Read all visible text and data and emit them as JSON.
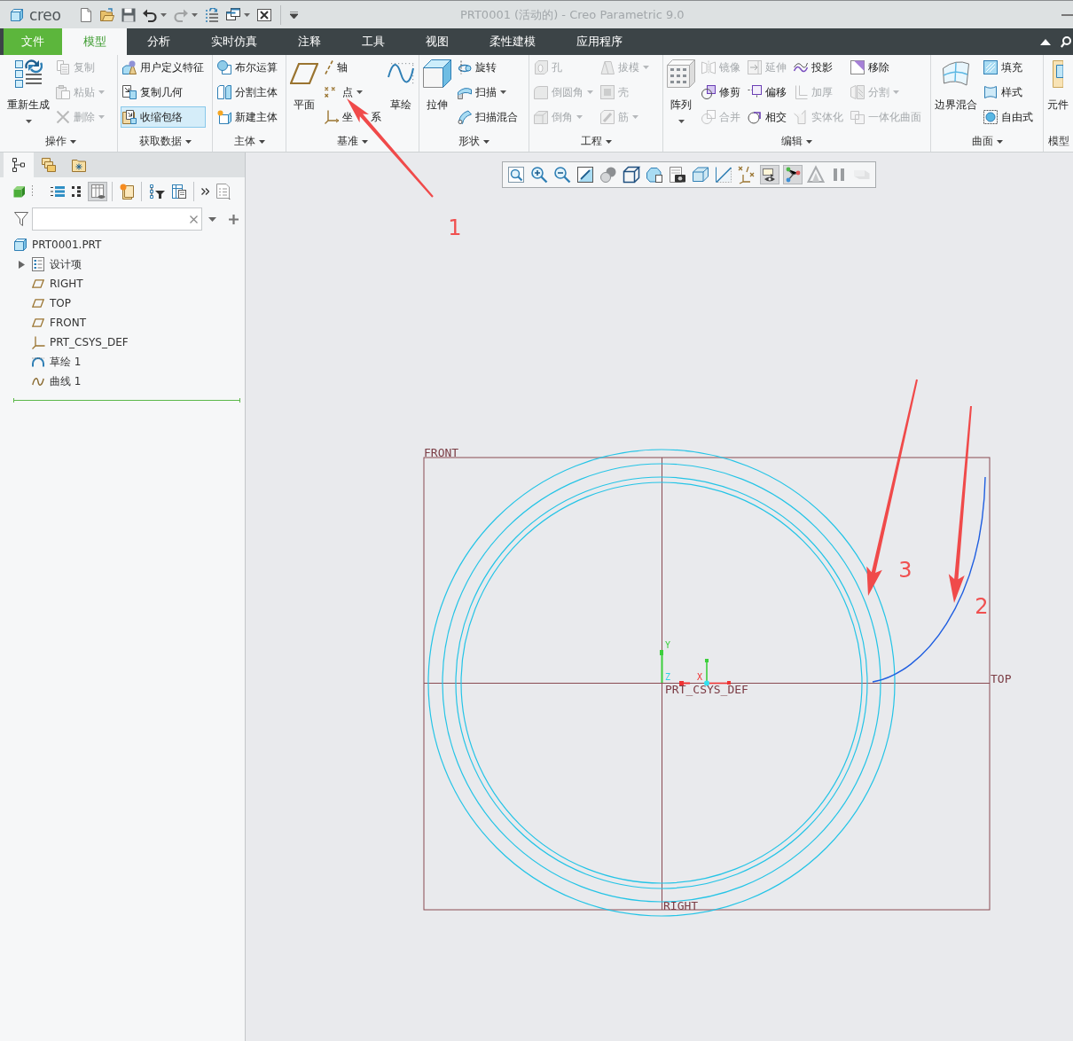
{
  "title_bar": {
    "logo": "creo",
    "title": "PRT0001 (活动的) - Creo Parametric 9.0",
    "quick_access": [
      {
        "dropdown": false,
        "disabled": false
      },
      {
        "dropdown": false,
        "disabled": false
      },
      {
        "dropdown": false,
        "disabled": false
      },
      {
        "dropdown": true,
        "disabled": false
      },
      {
        "dropdown": true,
        "disabled": true
      },
      {
        "dropdown": false,
        "disabled": false
      },
      {
        "dropdown": true,
        "disabled": false
      },
      {
        "dropdown": false,
        "disabled": false
      }
    ]
  },
  "menu_tabs": [
    {
      "label": "文件",
      "kind": "file",
      "selected": false
    },
    {
      "label": "模型",
      "kind": "tab",
      "selected": true
    },
    {
      "label": "分析",
      "kind": "tab",
      "selected": false
    },
    {
      "label": "实时仿真",
      "kind": "tab",
      "selected": false
    },
    {
      "label": "注释",
      "kind": "tab",
      "selected": false
    },
    {
      "label": "工具",
      "kind": "tab",
      "selected": false
    },
    {
      "label": "视图",
      "kind": "tab",
      "selected": false
    },
    {
      "label": "柔性建模",
      "kind": "tab",
      "selected": false
    },
    {
      "label": "应用程序",
      "kind": "tab",
      "selected": false
    }
  ],
  "ribbon_groups": [
    {
      "label": "操作",
      "dropdown": true,
      "columns": [
        [
          {
            "label": "重新生成",
            "kind": "large",
            "dropdown": true,
            "disabled": false,
            "active": false
          }
        ],
        [
          {
            "label": "复制",
            "kind": "small",
            "dropdown": false,
            "disabled": true,
            "active": false
          },
          {
            "label": "粘贴",
            "kind": "small",
            "dropdown": true,
            "disabled": true,
            "active": false
          },
          {
            "label": "删除",
            "kind": "small",
            "dropdown": true,
            "disabled": true,
            "active": false
          }
        ]
      ]
    },
    {
      "label": "获取数据",
      "dropdown": true,
      "columns": [
        [
          {
            "label": "用户定义特征",
            "kind": "small",
            "dropdown": false,
            "disabled": false,
            "active": false
          },
          {
            "label": "复制几何",
            "kind": "small",
            "dropdown": false,
            "disabled": false,
            "active": false
          },
          {
            "label": "收缩包络",
            "kind": "small",
            "dropdown": false,
            "disabled": false,
            "active": true
          }
        ]
      ]
    },
    {
      "label": "主体",
      "dropdown": true,
      "columns": [
        [
          {
            "label": "布尔运算",
            "kind": "small",
            "dropdown": false,
            "disabled": false,
            "active": false
          },
          {
            "label": "分割主体",
            "kind": "small",
            "dropdown": false,
            "disabled": false,
            "active": false
          },
          {
            "label": "新建主体",
            "kind": "small",
            "dropdown": false,
            "disabled": false,
            "active": false
          }
        ]
      ]
    },
    {
      "label": "基准",
      "dropdown": true,
      "columns": [
        [
          {
            "label": "平面",
            "kind": "large",
            "dropdown": false,
            "disabled": false,
            "active": false
          }
        ],
        [
          {
            "label": "轴",
            "kind": "small",
            "dropdown": false,
            "disabled": false,
            "active": false
          },
          {
            "label": "点",
            "kind": "small",
            "dropdown": true,
            "disabled": false,
            "active": false
          },
          {
            "label": "坐 系",
            "kind": "small",
            "dropdown": false,
            "disabled": false,
            "active": false
          }
        ],
        [
          {
            "label": "草绘",
            "kind": "large",
            "dropdown": false,
            "disabled": false,
            "active": false
          }
        ]
      ]
    },
    {
      "label": "形状",
      "dropdown": true,
      "columns": [
        [
          {
            "label": "拉伸",
            "kind": "large",
            "dropdown": false,
            "disabled": false,
            "active": false
          }
        ],
        [
          {
            "label": "旋转",
            "kind": "small",
            "dropdown": false,
            "disabled": false,
            "active": false
          },
          {
            "label": "扫描",
            "kind": "small",
            "dropdown": true,
            "disabled": false,
            "active": false
          },
          {
            "label": "扫描混合",
            "kind": "small",
            "dropdown": false,
            "disabled": false,
            "active": false
          }
        ]
      ]
    },
    {
      "label": "工程",
      "dropdown": true,
      "columns": [
        [
          {
            "label": "孔",
            "kind": "small",
            "dropdown": false,
            "disabled": true,
            "active": false
          },
          {
            "label": "倒圆角",
            "kind": "small",
            "dropdown": true,
            "disabled": true,
            "active": false
          },
          {
            "label": "倒角",
            "kind": "small",
            "dropdown": true,
            "disabled": true,
            "active": false
          }
        ],
        [
          {
            "label": "拔模",
            "kind": "small",
            "dropdown": true,
            "disabled": true,
            "active": false
          },
          {
            "label": "壳",
            "kind": "small",
            "dropdown": false,
            "disabled": true,
            "active": false
          },
          {
            "label": "筋",
            "kind": "small",
            "dropdown": true,
            "disabled": true,
            "active": false
          }
        ]
      ]
    },
    {
      "label": "编辑",
      "dropdown": true,
      "columns": [
        [
          {
            "label": "阵列",
            "kind": "large",
            "dropdown": true,
            "disabled": false,
            "active": false
          }
        ],
        [
          {
            "label": "镜像",
            "kind": "small",
            "dropdown": false,
            "disabled": true,
            "active": false
          },
          {
            "label": "修剪",
            "kind": "small",
            "dropdown": false,
            "disabled": false,
            "active": false
          },
          {
            "label": "合并",
            "kind": "small",
            "dropdown": false,
            "disabled": true,
            "active": false
          }
        ],
        [
          {
            "label": "延伸",
            "kind": "small",
            "dropdown": false,
            "disabled": true,
            "active": false
          },
          {
            "label": "偏移",
            "kind": "small",
            "dropdown": false,
            "disabled": false,
            "active": false
          },
          {
            "label": "相交",
            "kind": "small",
            "dropdown": false,
            "disabled": false,
            "active": false
          }
        ],
        [
          {
            "label": "投影",
            "kind": "small",
            "dropdown": false,
            "disabled": false,
            "active": false
          },
          {
            "label": "加厚",
            "kind": "small",
            "dropdown": false,
            "disabled": true,
            "active": false
          },
          {
            "label": "实体化",
            "kind": "small",
            "dropdown": false,
            "disabled": true,
            "active": false
          }
        ],
        [
          {
            "label": "移除",
            "kind": "small",
            "dropdown": false,
            "disabled": false,
            "active": false
          },
          {
            "label": "分割",
            "kind": "small",
            "dropdown": true,
            "disabled": true,
            "active": false
          },
          {
            "label": "一体化曲面",
            "kind": "small",
            "dropdown": false,
            "disabled": true,
            "active": false
          }
        ]
      ]
    },
    {
      "label": "曲面",
      "dropdown": true,
      "columns": [
        [
          {
            "label": "边界混合",
            "kind": "large",
            "dropdown": false,
            "disabled": false,
            "active": false
          }
        ],
        [
          {
            "label": "填充",
            "kind": "small",
            "dropdown": false,
            "disabled": false,
            "active": false
          },
          {
            "label": "样式",
            "kind": "small",
            "dropdown": false,
            "disabled": false,
            "active": false
          },
          {
            "label": "自由式",
            "kind": "small",
            "dropdown": false,
            "disabled": false,
            "active": false
          }
        ]
      ]
    },
    {
      "label": "模型",
      "dropdown": false,
      "columns": [
        [
          {
            "label": "元件",
            "kind": "large",
            "dropdown": false,
            "disabled": false,
            "active": false
          }
        ]
      ]
    }
  ],
  "model_tree": {
    "tabs": [
      {
        "selected": true
      },
      {
        "selected": false
      },
      {
        "selected": false
      }
    ],
    "toolbar": [
      {
        "pressed": false
      },
      {
        "pressed": false
      },
      {
        "pressed": false
      },
      {
        "pressed": true
      },
      {
        "pressed": false
      },
      {
        "pressed": false
      },
      {
        "pressed": false
      },
      {
        "pressed": false
      },
      {
        "pressed": false
      }
    ],
    "items": [
      {
        "label": "PRT0001.PRT",
        "children": [
          {
            "label": "设计项",
            "expanded": false
          },
          {
            "label": "RIGHT"
          },
          {
            "label": "TOP"
          },
          {
            "label": "FRONT"
          },
          {
            "label": "PRT_CSYS_DEF"
          },
          {
            "label": "草绘 1"
          },
          {
            "label": "曲线 1"
          }
        ]
      }
    ]
  },
  "graphics_toolbar": [
    {
      "pressed": false,
      "disabled": false
    },
    {
      "pressed": false,
      "disabled": false
    },
    {
      "pressed": false,
      "disabled": false
    },
    {
      "pressed": false,
      "disabled": false
    },
    {
      "pressed": false,
      "disabled": false
    },
    {
      "pressed": false,
      "disabled": false
    },
    {
      "pressed": false,
      "disabled": false
    },
    {
      "pressed": false,
      "disabled": false
    },
    {
      "pressed": false,
      "disabled": false
    },
    {
      "pressed": false,
      "disabled": false
    },
    {
      "pressed": false,
      "disabled": false
    },
    {
      "pressed": true,
      "disabled": false
    },
    {
      "pressed": true,
      "disabled": false
    },
    {
      "pressed": false,
      "disabled": false
    },
    {
      "pressed": false,
      "disabled": false
    },
    {
      "pressed": false,
      "disabled": true
    }
  ],
  "canvas": {
    "datum_labels": [
      "FRONT",
      "TOP",
      "RIGHT"
    ],
    "csys_label": "PRT_CSYS_DEF",
    "axis_labels": [
      "Y",
      "Z",
      "X"
    ]
  },
  "annotations": [
    {
      "label": "1"
    },
    {
      "label": "3"
    },
    {
      "label": "2"
    }
  ]
}
